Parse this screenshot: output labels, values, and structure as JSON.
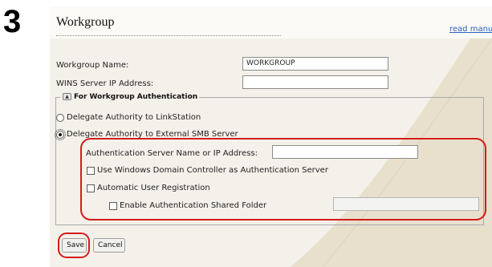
{
  "step": {
    "number": "3"
  },
  "header": {
    "title": "Workgroup",
    "read_manual": "read manual"
  },
  "form": {
    "workgroup_name": {
      "label": "Workgroup Name:",
      "value": "WORKGROUP"
    },
    "wins_server": {
      "label": "WINS Server IP Address:",
      "value": ""
    }
  },
  "auth_section": {
    "legend": "For Workgroup Authentication",
    "collapse_glyph": "▲",
    "options": [
      {
        "label": "Delegate Authority to LinkStation",
        "selected": false
      },
      {
        "label": "Delegate Authority to External SMB Server",
        "selected": true
      }
    ],
    "server_name": {
      "label": "Authentication Server Name or IP Address:",
      "value": ""
    },
    "use_domain_controller": {
      "label": "Use Windows Domain Controller as Authentication Server",
      "checked": false
    },
    "auto_registration": {
      "label": "Automatic User Registration",
      "checked": false
    },
    "shared_folder": {
      "label": "Enable Authentication Shared Folder",
      "checked": false,
      "value": ""
    }
  },
  "actions": {
    "save": "Save",
    "cancel": "Cancel"
  },
  "colors": {
    "annotation_red": "#d41c1c",
    "link_blue": "#2b62c0",
    "panel_bg": "#f4f1ea",
    "swoosh": "#e8e0cc"
  }
}
